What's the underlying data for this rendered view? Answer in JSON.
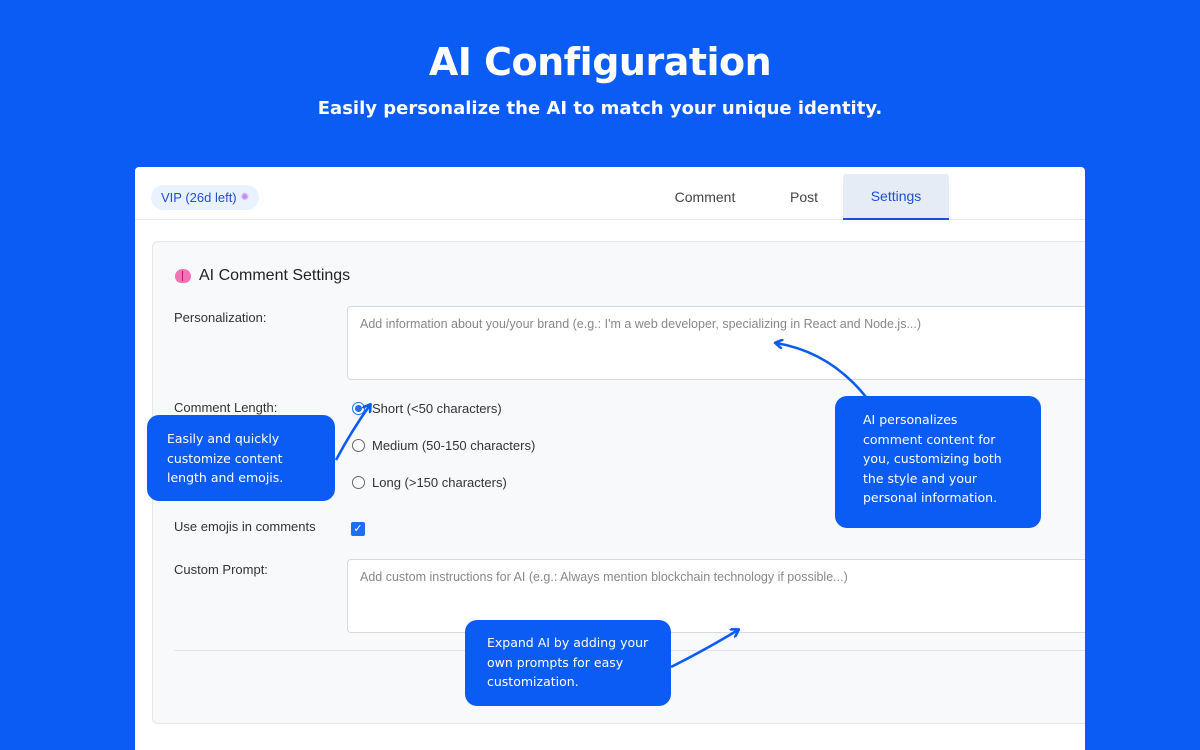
{
  "hero": {
    "title": "AI Configuration",
    "subtitle": "Easily personalize the AI to match your unique identity."
  },
  "header": {
    "vip_badge": "VIP (26d left)",
    "tabs": [
      {
        "label": "Comment",
        "active": false
      },
      {
        "label": "Post",
        "active": false
      },
      {
        "label": "Settings",
        "active": true
      }
    ]
  },
  "settings": {
    "section_title": "AI Comment Settings",
    "personalization": {
      "label": "Personalization:",
      "placeholder": "Add information about you/your brand (e.g.: I'm a web developer, specializing in React and Node.js...)"
    },
    "comment_length": {
      "label": "Comment Length:",
      "options": [
        {
          "label": "Short (<50 characters)",
          "checked": true
        },
        {
          "label": "Medium (50-150 characters)",
          "checked": false
        },
        {
          "label": "Long (>150 characters)",
          "checked": false
        }
      ]
    },
    "emojis": {
      "label": "Use emojis in comments",
      "checked": true
    },
    "custom_prompt": {
      "label": "Custom Prompt:",
      "placeholder": "Add custom instructions for AI (e.g.: Always mention blockchain technology if possible...)"
    }
  },
  "callouts": {
    "length": "Easily and quickly customize content length and emojis.",
    "personalize": "AI personalizes comment content for you, customizing both the style and your personal information.",
    "prompt": "Expand AI by adding your own prompts for easy customization."
  },
  "colors": {
    "background": "#0b5cf5",
    "accent": "#1d6ef2",
    "active_tab_bg": "#e6ecf5"
  }
}
